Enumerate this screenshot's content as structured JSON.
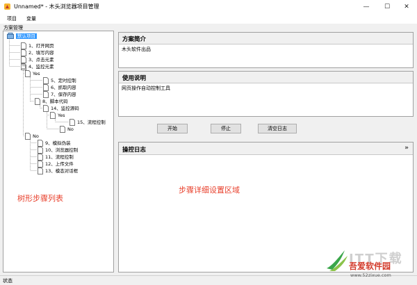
{
  "window": {
    "title": "Unnamed* - 木头浏览器项目管理",
    "minimize_glyph": "—",
    "maximize_glyph": "☐",
    "close_glyph": "✕"
  },
  "menu": {
    "items": [
      "项目",
      "变量"
    ]
  },
  "tree_panel": {
    "caption": "方案管理"
  },
  "tree": {
    "root": "默认项目",
    "n1": "1、打开网页",
    "n2": "2、填写内容",
    "n3": "3、点击元素",
    "n4": "4、监控元素",
    "yes1": "Yes",
    "n5": "5、定时控制",
    "n6": "6、抓取内容",
    "n7": "7、保存内容",
    "n8": "8、脚本代码",
    "n14": "14、监控源码",
    "yes2": "Yes",
    "n15": "15、流程控制",
    "no2": "No",
    "no1": "No",
    "n9": "9、模拟伪装",
    "n10": "10、浏览器控制",
    "n11": "11、流程控制",
    "n12": "12、上传文件",
    "n13": "13、模态对话框",
    "toggle_minus": "−"
  },
  "annotations": {
    "tree_label": "树形步骤列表",
    "detail_label": "步骤详细设置区域"
  },
  "intro": {
    "header": "方案简介",
    "body": "木头软件出品"
  },
  "usage": {
    "header": "使用说明",
    "body": "网页操作自动控制工具"
  },
  "buttons": {
    "start": "开始",
    "stop": "停止",
    "clear_log": "清空日志"
  },
  "log": {
    "header": "操控日志",
    "collapse_glyph": "»"
  },
  "status": {
    "text": "状态"
  },
  "watermark": {
    "big": "ITT下载",
    "name": "吾爱软件园",
    "url": "www.52zixue.com"
  },
  "colors": {
    "selection": "#3399ff",
    "annotation": "#e8402c",
    "watermark_red": "#d23a2a"
  }
}
